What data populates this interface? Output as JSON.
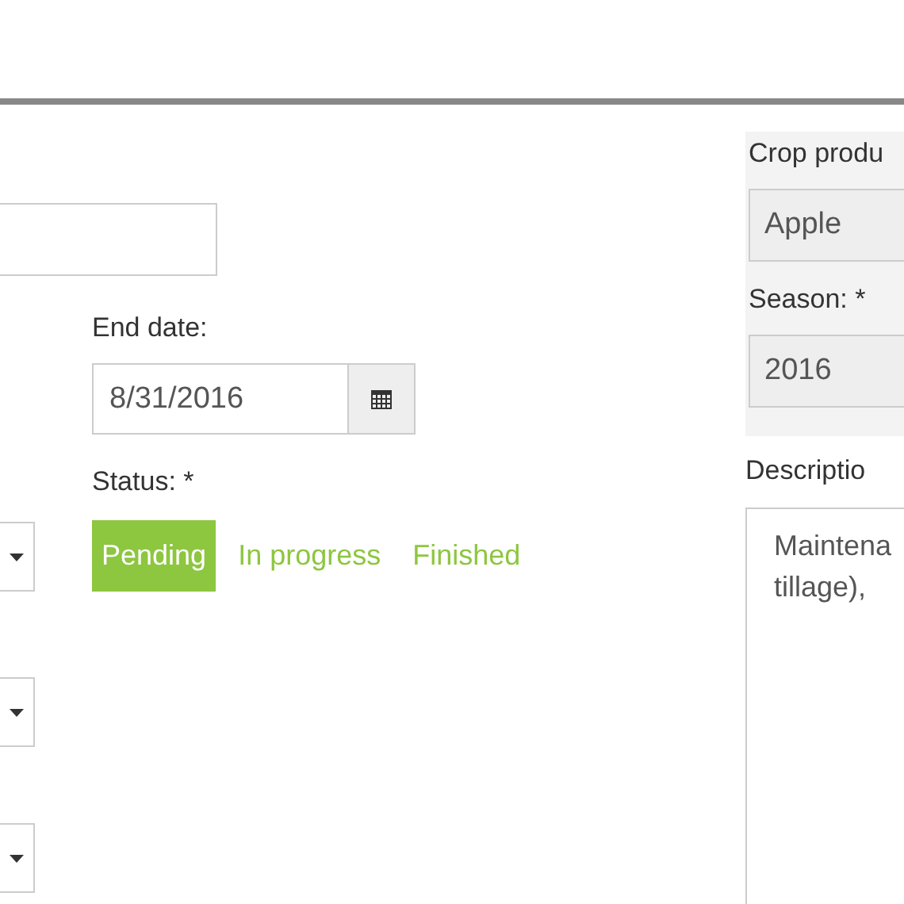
{
  "end_date": {
    "label": "End date:",
    "value": "8/31/2016"
  },
  "status": {
    "label": "Status: *",
    "options": [
      {
        "label": "Pending",
        "selected": true
      },
      {
        "label": "In progress",
        "selected": false
      },
      {
        "label": "Finished",
        "selected": false
      }
    ]
  },
  "crop_product": {
    "label": "Crop produ",
    "value": "Apple"
  },
  "season": {
    "label": "Season: *",
    "value": "2016"
  },
  "description": {
    "label": "Descriptio",
    "lines": [
      "Maintena",
      "tillage),"
    ]
  }
}
